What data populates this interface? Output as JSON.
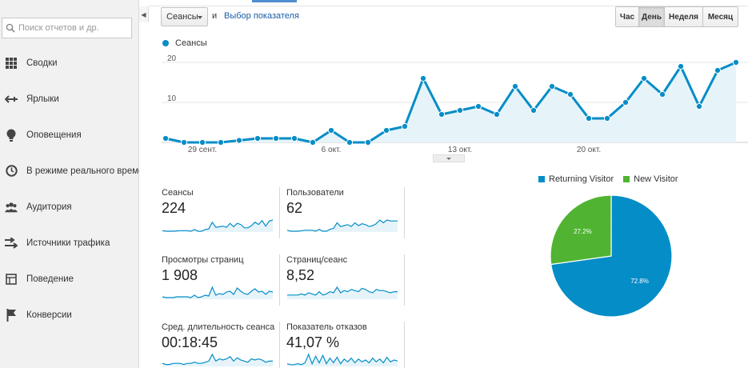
{
  "sidebar": {
    "search_placeholder": "Поиск отчетов и др.",
    "items": [
      {
        "label": "Сводки",
        "icon": "grid-icon"
      },
      {
        "label": "Ярлыки",
        "icon": "shortcut-arrow-icon"
      },
      {
        "label": "Оповещения",
        "icon": "lightbulb-icon"
      },
      {
        "label": "В режиме реального времени",
        "icon": "clock-icon"
      },
      {
        "label": "Аудитория",
        "icon": "people-icon"
      },
      {
        "label": "Источники трафика",
        "icon": "arrows-icon"
      },
      {
        "label": "Поведение",
        "icon": "layout-icon"
      },
      {
        "label": "Конверсии",
        "icon": "flag-icon"
      }
    ]
  },
  "toolbar": {
    "metric_selected": "Сеансы",
    "and_text": "и",
    "choose_metric": "Выбор показателя",
    "periods": [
      "Час",
      "День",
      "Неделя",
      "Месяц"
    ],
    "active_period": "День"
  },
  "chart_data": [
    {
      "type": "area",
      "series": [
        {
          "name": "Сеансы",
          "values": [
            1,
            0,
            0,
            0,
            0.5,
            1,
            1,
            1,
            0,
            3,
            0,
            0,
            3,
            4,
            16,
            7,
            8,
            9,
            7,
            14,
            8,
            14,
            12,
            6,
            6,
            10,
            16,
            12,
            19,
            9,
            18,
            20
          ]
        }
      ],
      "x_tick_labels": [
        "29 сент.",
        "6 окт.",
        "13 окт.",
        "20 окт."
      ],
      "y_ticks": [
        10,
        20
      ],
      "ylim": [
        0,
        22
      ],
      "grid": true,
      "colors": {
        "line": "#058dc7",
        "fill": "#e6f4fa"
      }
    },
    {
      "type": "pie",
      "labels": [
        "Returning Visitor",
        "New Visitor"
      ],
      "values": [
        72.8,
        27.2
      ],
      "value_labels": [
        "72.8%",
        "27.2%"
      ],
      "colors": [
        "#058dc7",
        "#50b432"
      ],
      "legend": "top"
    }
  ],
  "scorecards": [
    {
      "title": "Сеансы",
      "value": "224",
      "spark": [
        1,
        0,
        0,
        0,
        0.5,
        1,
        1,
        1,
        0,
        3,
        0,
        0,
        3,
        4,
        16,
        7,
        8,
        9,
        7,
        14,
        8,
        14,
        12,
        6,
        6,
        10,
        16,
        12,
        19,
        9,
        18,
        20
      ]
    },
    {
      "title": "Пользователи",
      "value": "62",
      "spark": [
        1,
        0,
        0,
        0,
        0.5,
        1,
        1,
        1,
        0,
        2,
        0,
        0,
        2,
        3,
        9,
        5,
        6,
        7,
        5,
        9,
        6,
        8,
        7,
        5,
        6,
        8,
        12,
        9,
        12,
        11,
        11,
        11
      ]
    },
    {
      "title": "Просмотры страниц",
      "value": "1 908",
      "spark": [
        2,
        1,
        1,
        1,
        2,
        2,
        2,
        2,
        1,
        4,
        1,
        2,
        4,
        3,
        14,
        4,
        6,
        5,
        8,
        9,
        5,
        13,
        9,
        6,
        5,
        9,
        12,
        8,
        9,
        5,
        9,
        8
      ]
    },
    {
      "title": "Страниц/сеанс",
      "value": "8,52",
      "spark": [
        3,
        3,
        3,
        3,
        4,
        3,
        5,
        4,
        3,
        6,
        3,
        4,
        6,
        5,
        10,
        5,
        7,
        6,
        8,
        7,
        6,
        9,
        8,
        6,
        5,
        8,
        7,
        7,
        6,
        5,
        6,
        6
      ]
    },
    {
      "title": "Сред. длительность сеанса",
      "value": "00:18:45",
      "spark": [
        2,
        1,
        1,
        2,
        2,
        2,
        1,
        2,
        2,
        3,
        2,
        2,
        3,
        4,
        10,
        4,
        6,
        5,
        6,
        8,
        4,
        7,
        5,
        4,
        3,
        6,
        5,
        6,
        5,
        3,
        4,
        4
      ]
    },
    {
      "title": "Показатель отказов",
      "value": "41,07 %",
      "spark": [
        2,
        1,
        1,
        2,
        1,
        3,
        12,
        2,
        10,
        3,
        11,
        2,
        8,
        3,
        9,
        2,
        7,
        4,
        8,
        3,
        7,
        4,
        6,
        3,
        8,
        4,
        7,
        3,
        9,
        4,
        6,
        5
      ]
    }
  ]
}
